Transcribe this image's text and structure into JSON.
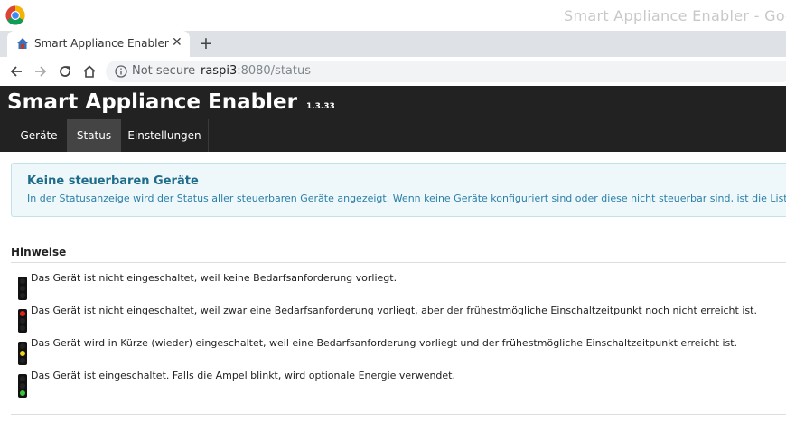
{
  "window": {
    "title": "Smart Appliance Enabler - Goog"
  },
  "browser": {
    "tab": {
      "title": "Smart Appliance Enabler"
    },
    "address": {
      "security_label": "Not secure",
      "host": "raspi3",
      "path": ":8080/status"
    }
  },
  "app": {
    "brand": "Smart Appliance Enabler",
    "version": "1.3.33",
    "nav": [
      {
        "label": "Geräte",
        "active": false
      },
      {
        "label": "Status",
        "active": true
      },
      {
        "label": "Einstellungen",
        "active": false
      }
    ]
  },
  "alert": {
    "title": "Keine steuerbaren Geräte",
    "text": "In der Statusanzeige wird der Status aller steuerbaren Geräte angezeigt. Wenn keine Geräte konfiguriert sind oder diese nicht steuerbar sind, ist die Liste leer."
  },
  "hints": {
    "heading": "Hinweise",
    "items": [
      {
        "lamp": "off",
        "text": "Das Gerät ist nicht eingeschaltet, weil keine Bedarfsanforderung vorliegt."
      },
      {
        "lamp": "red",
        "text": "Das Gerät ist nicht eingeschaltet, weil zwar eine Bedarfsanforderung vorliegt, aber der frühestmögliche Einschaltzeitpunkt noch nicht erreicht ist."
      },
      {
        "lamp": "yellow",
        "text": "Das Gerät wird in Kürze (wieder) eingeschaltet, weil eine Bedarfsanforderung vorliegt und der frühestmögliche Einschaltzeitpunkt erreicht ist."
      },
      {
        "lamp": "green",
        "text": "Das Gerät ist eingeschaltet. Falls die Ampel blinkt, wird optionale Energie verwendet."
      }
    ]
  },
  "colors": {
    "navbar": "#222222",
    "lamp_red": "#e8201c",
    "lamp_yellow": "#f2d31b",
    "lamp_green": "#3cc23c",
    "alert_bg": "#eef8fb"
  },
  "icons": {
    "browser": "chrome-logo-icon",
    "favicon": "house-favicon-icon",
    "back": "arrow-left-icon",
    "forward": "arrow-right-icon",
    "reload": "reload-icon",
    "home": "home-icon",
    "info": "info-icon",
    "traffic_light": "traffic-light-icon"
  }
}
